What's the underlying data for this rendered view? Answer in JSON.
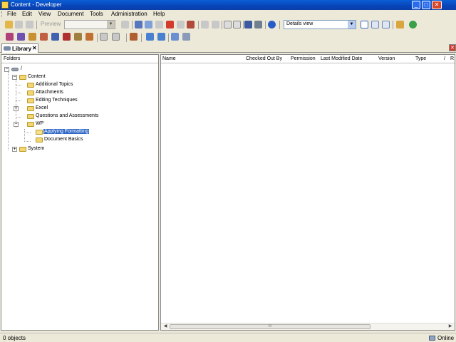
{
  "window": {
    "title": "Content - Developer"
  },
  "menu": [
    "File",
    "Edit",
    "View",
    "Document",
    "Tools",
    "Administration",
    "Help"
  ],
  "toolbar": {
    "preview_label": "Preview",
    "view_mode": "Details view"
  },
  "tabs": {
    "library": "Library",
    "close": "✕"
  },
  "folders_pane": {
    "header": "Folders",
    "tree": [
      {
        "label": "/",
        "icon": "drive-icon",
        "expander": "−"
      },
      {
        "label": "Content",
        "icon": "folder-icon",
        "expander": "−"
      },
      {
        "label": "Additional Topics",
        "icon": "folder-icon",
        "expander": ""
      },
      {
        "label": "Attachments",
        "icon": "folder-icon",
        "expander": ""
      },
      {
        "label": "Editing Techniques",
        "icon": "folder-icon",
        "expander": ""
      },
      {
        "label": "Excel",
        "icon": "folder-icon",
        "expander": "+"
      },
      {
        "label": "Questions and Assessments",
        "icon": "folder-icon",
        "expander": ""
      },
      {
        "label": "WP",
        "icon": "folder-icon",
        "expander": "−"
      },
      {
        "label": "Applying Formatting",
        "icon": "folder-icon",
        "expander": "",
        "selected": true
      },
      {
        "label": "Document Basics",
        "icon": "folder-icon",
        "expander": ""
      },
      {
        "label": "System",
        "icon": "folder-icon",
        "expander": "+"
      }
    ]
  },
  "details_pane": {
    "columns": [
      "Name",
      "Checked Out By",
      "Permission",
      "Last Modified Date",
      "Version",
      "Type",
      "/",
      "R"
    ],
    "scroll_thumb": "III"
  },
  "status": {
    "count": "0 objects",
    "connection": "Online"
  }
}
